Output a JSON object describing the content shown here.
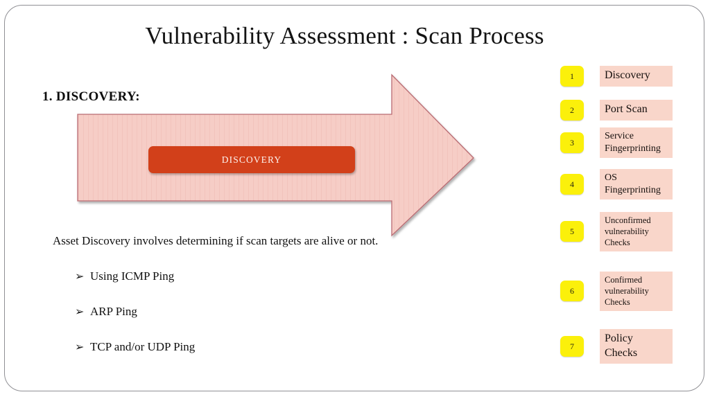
{
  "slide": {
    "title": "Vulnerability Assessment : Scan Process",
    "section_heading": "1. DISCOVERY:",
    "lead_text": "Asset Discovery involves determining if scan targets are alive or not."
  },
  "arrow": {
    "label": "DISCOVERY",
    "fill_color": "#f6cdc6",
    "outline_color": "#b96b72",
    "label_box_color": "#d2401a",
    "label_text_color": "#fdf3ef"
  },
  "bullets": [
    {
      "marker": "➢",
      "label": "Using ICMP Ping"
    },
    {
      "marker": "➢",
      "label": "ARP Ping"
    },
    {
      "marker": "➢",
      "label": "TCP and/or UDP Ping"
    }
  ],
  "steps": {
    "badge_color": "#fbf00b",
    "box_color": "#f9d6ca",
    "items": [
      {
        "number": "1",
        "label": "Discovery",
        "size": "sz-lg"
      },
      {
        "number": "2",
        "label": "Port Scan",
        "size": "sz-lg"
      },
      {
        "number": "3",
        "label": "Service Fingerprinting",
        "size": "sz-md"
      },
      {
        "number": "4",
        "label": "OS Fingerprinting",
        "size": "sz-md"
      },
      {
        "number": "5",
        "label": "Unconfirmed vulnerability Checks",
        "size": "sz-sm"
      },
      {
        "number": "6",
        "label": "Confirmed vulnerability Checks",
        "size": "sz-sm"
      },
      {
        "number": "7",
        "label": "Policy Checks",
        "size": "sz-lg"
      }
    ]
  }
}
